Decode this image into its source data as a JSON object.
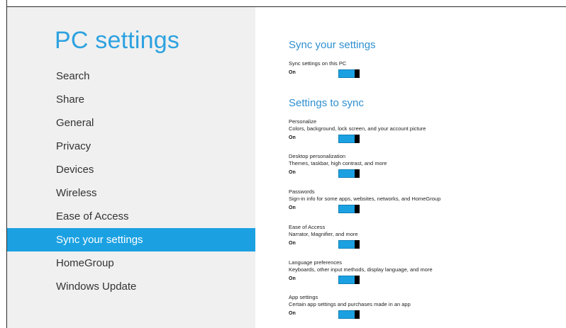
{
  "sidebar": {
    "title": "PC settings",
    "items": [
      {
        "label": "Search"
      },
      {
        "label": "Share"
      },
      {
        "label": "General"
      },
      {
        "label": "Privacy"
      },
      {
        "label": "Devices"
      },
      {
        "label": "Wireless"
      },
      {
        "label": "Ease of Access"
      },
      {
        "label": "Sync your settings",
        "selected": true
      },
      {
        "label": "HomeGroup"
      },
      {
        "label": "Windows Update"
      }
    ]
  },
  "main": {
    "sync_header": "Sync your settings",
    "sync_toggle": {
      "title": "Sync settings on this PC",
      "state": "On",
      "on": true
    },
    "settings_header": "Settings to sync",
    "settings": [
      {
        "title": "Personalize",
        "description": "Colors, background, lock screen, and your account picture",
        "state": "On",
        "on": true
      },
      {
        "title": "Desktop personalization",
        "description": "Themes, taskbar, high contrast, and more",
        "state": "On",
        "on": true
      },
      {
        "title": "Passwords",
        "description": "Sign-in info for some apps, websites, networks, and HomeGroup",
        "state": "On",
        "on": true
      },
      {
        "title": "Ease of Access",
        "description": "Narrator, Magnifier, and more",
        "state": "On",
        "on": true
      },
      {
        "title": "Language preferences",
        "description": "Keyboards, other input methods, display language, and more",
        "state": "On",
        "on": true
      },
      {
        "title": "App settings",
        "description": "Certain app settings and purchases made in an app",
        "state": "On",
        "on": true
      }
    ]
  },
  "colors": {
    "accent": "#1ba1e2",
    "title": "#2da2e0",
    "sidebar_bg": "#f0f0f0"
  }
}
